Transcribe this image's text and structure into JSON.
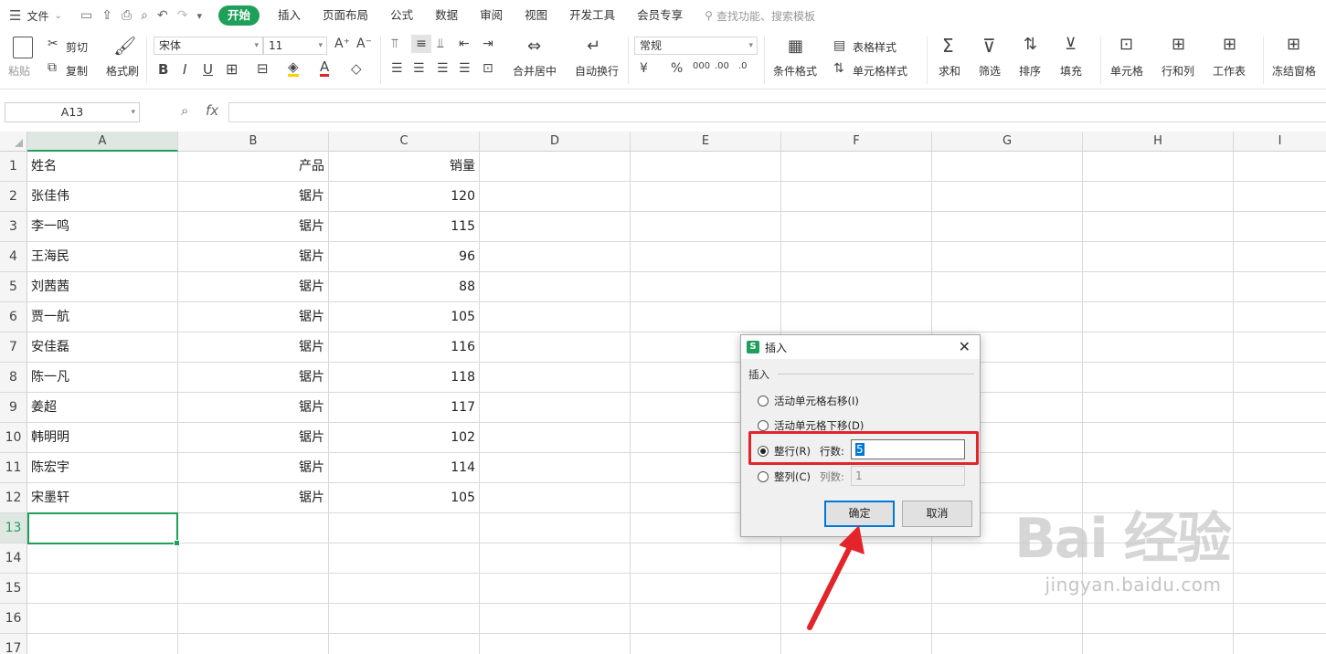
{
  "menubar": {
    "file_label": "文件",
    "tabs": [
      "开始",
      "插入",
      "页面布局",
      "公式",
      "数据",
      "审阅",
      "视图",
      "开发工具",
      "会员专享"
    ],
    "search_placeholder": "查找功能、搜索模板"
  },
  "ribbon": {
    "paste": "粘贴",
    "cut": "剪切",
    "copy": "复制",
    "format_painter": "格式刷",
    "font_name": "宋体",
    "font_size": "11",
    "merge_center": "合并居中",
    "wrap_text": "自动换行",
    "number_format": "常规",
    "conditional_format": "条件格式",
    "table_style": "表格样式",
    "cell_style": "单元格样式",
    "sum": "求和",
    "filter": "筛选",
    "sort": "排序",
    "fill": "填充",
    "cell": "单元格",
    "row_col": "行和列",
    "worksheet": "工作表",
    "freeze": "冻结窗格"
  },
  "formula_bar": {
    "name_box": "A13",
    "fx": "fx"
  },
  "columns": [
    "A",
    "B",
    "C",
    "D",
    "E",
    "F",
    "G",
    "H",
    "I"
  ],
  "rows": [
    "1",
    "2",
    "3",
    "4",
    "5",
    "6",
    "7",
    "8",
    "9",
    "10",
    "11",
    "12",
    "13",
    "14",
    "15",
    "16",
    "17"
  ],
  "sheet": [
    [
      "姓名",
      "产品",
      "销量"
    ],
    [
      "张佳伟",
      "锯片",
      "120"
    ],
    [
      "李一鸣",
      "锯片",
      "115"
    ],
    [
      "王海民",
      "锯片",
      "96"
    ],
    [
      "刘茜茜",
      "锯片",
      "88"
    ],
    [
      "贾一航",
      "锯片",
      "105"
    ],
    [
      "安佳磊",
      "锯片",
      "116"
    ],
    [
      "陈一凡",
      "锯片",
      "118"
    ],
    [
      "姜超",
      "锯片",
      "117"
    ],
    [
      "韩明明",
      "锯片",
      "102"
    ],
    [
      "陈宏宇",
      "锯片",
      "114"
    ],
    [
      "宋墨轩",
      "锯片",
      "105"
    ]
  ],
  "dialog": {
    "title": "插入",
    "group_label": "插入",
    "option_right": "活动单元格右移(I)",
    "option_down": "活动单元格下移(D)",
    "option_row": "整行(R)",
    "option_col": "整列(C)",
    "rows_label": "行数:",
    "rows_value": "5",
    "cols_label": "列数:",
    "cols_value": "1",
    "ok": "确定",
    "cancel": "取消"
  },
  "watermark": {
    "main": "Bai 经验",
    "sub": "jingyan.baidu.com"
  },
  "colors": {
    "accent": "#1e9f5a",
    "highlight": "#e3242b"
  }
}
